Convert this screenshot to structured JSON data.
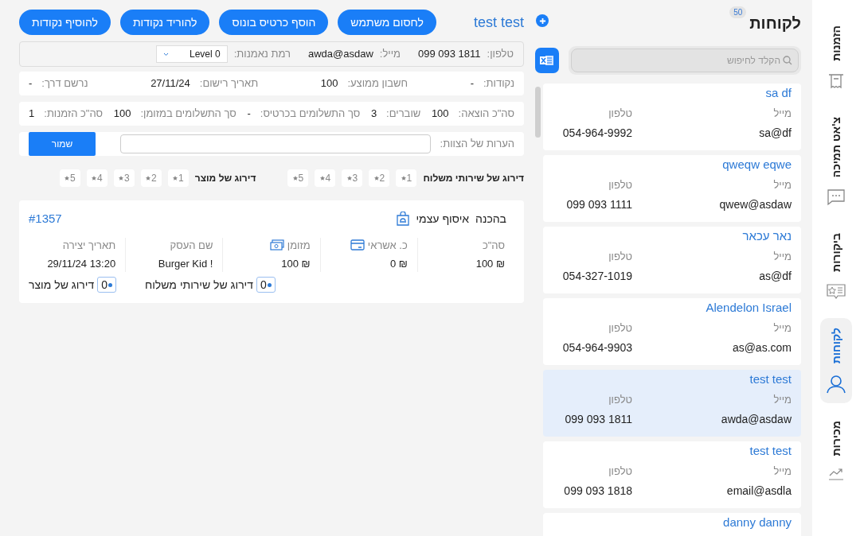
{
  "nav": [
    {
      "label": "הזמנות",
      "kind": "receipt",
      "selected": false
    },
    {
      "label": "צ'אט תמיכה",
      "kind": "chat",
      "selected": false
    },
    {
      "label": "ביקורות",
      "kind": "review",
      "selected": false
    },
    {
      "label": "לקוחות",
      "kind": "user",
      "selected": true
    },
    {
      "label": "מכירות",
      "kind": "chart",
      "selected": false
    }
  ],
  "customers": {
    "title": "לקוחות",
    "count": "50",
    "search_placeholder": "הקלד לחיפוש",
    "items": [
      {
        "name": "sa df",
        "email_label": "מייל",
        "phone_label": "טלפון",
        "email": "sa@df",
        "phone": "054-964-9992",
        "selected": false
      },
      {
        "name": "qweqw eqwe",
        "email_label": "מייל",
        "phone_label": "טלפון",
        "email": "qwew@asdaw",
        "phone": "099 093 1111",
        "selected": false
      },
      {
        "name": "נאר עכאר",
        "email_label": "מייל",
        "phone_label": "טלפון",
        "email": "as@df",
        "phone": "054-327-1019",
        "selected": false
      },
      {
        "name": "Alendelon Israel",
        "email_label": "מייל",
        "phone_label": "טלפון",
        "email": "as@as.com",
        "phone": "054-964-9903",
        "selected": false
      },
      {
        "name": "test test",
        "email_label": "מייל",
        "phone_label": "טלפון",
        "email": "awda@asdaw",
        "phone": "099 093 1811",
        "selected": true
      },
      {
        "name": "test test",
        "email_label": "מייל",
        "phone_label": "טלפון",
        "email": "email@asdla",
        "phone": "099 093 1818",
        "selected": false
      },
      {
        "name": "danny danny",
        "selected": false
      }
    ]
  },
  "detail": {
    "name": "test test",
    "buttons": [
      "לחסום משתמש",
      "הוסף כרטיס בונוס",
      "להוריד נקודות",
      "להוסיף נקודות"
    ],
    "contact": [
      {
        "label": "טלפון:",
        "value": "099 093 1811"
      },
      {
        "label": "מייל:",
        "value": "awda@asdaw"
      }
    ],
    "loyalty": {
      "label": "רמת נאמנות:",
      "value": "Level 0"
    },
    "stats_rows": [
      [
        {
          "label": "נקודות:",
          "value": "-"
        },
        {
          "label": "חשבון ממוצע:",
          "value": "100"
        },
        {
          "label": "תאריך רישום:",
          "value": "27/11/24"
        },
        {
          "label": "נרשם דרך:",
          "value": "-"
        }
      ],
      [
        {
          "label": "סה\"כ הוצאה:",
          "value": "100"
        },
        {
          "label": "שוברים:",
          "value": "3"
        },
        {
          "label": "סך התשלומים בכרטיס:",
          "value": "-"
        },
        {
          "label": "סך התשלומים במזומן:",
          "value": "100"
        },
        {
          "label": "סה\"כ הזמנות:",
          "value": "1"
        }
      ]
    ],
    "notes": {
      "label": "הערות של הצוות:",
      "button": "שמור"
    },
    "ratings": [
      {
        "label": "דירוג של שירותי משלוח",
        "options": [
          "1",
          "2",
          "3",
          "4",
          "5"
        ]
      },
      {
        "label": "דירוג של מוצר",
        "options": [
          "1",
          "2",
          "3",
          "4",
          "5"
        ]
      }
    ]
  },
  "orders": [
    {
      "status": "בהכנה",
      "type": "איסוף עצמי",
      "number": "#1357",
      "columns": [
        {
          "label": "סה\"כ",
          "value": "100 ₪",
          "kind": "plain"
        },
        {
          "label": "כ. אשראי",
          "value": "0 ₪",
          "kind": "card"
        },
        {
          "label": "מזומן",
          "value": "100 ₪",
          "kind": "cash"
        },
        {
          "label": "שם העסק",
          "value": "Burger Kid !",
          "kind": "plain"
        },
        {
          "label": "תאריך יצירה",
          "value": "29/11/24 13:20",
          "kind": "plain"
        }
      ],
      "ratings": [
        {
          "label": "דירוג של שירותי משלוח",
          "value": "0"
        },
        {
          "label": "דירוג של מוצר",
          "value": "0"
        }
      ]
    }
  ]
}
